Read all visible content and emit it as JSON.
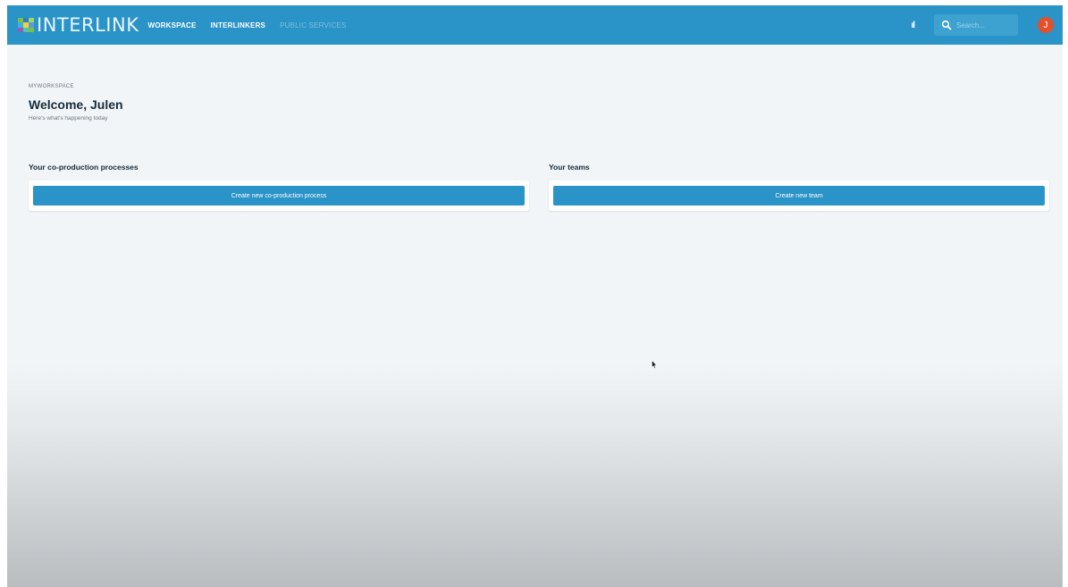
{
  "header": {
    "logo_text": "INTERLINK",
    "nav": [
      {
        "label": "WORKSPACE"
      },
      {
        "label": "INTERLINKERS"
      },
      {
        "label": "PUBLIC SERVICES"
      }
    ],
    "language_icon_text": "ıl",
    "search_placeholder": "Search...",
    "avatar_initial": "J"
  },
  "page": {
    "overline": "MYWORKSPACE",
    "title": "Welcome, Julen",
    "subtitle": "Here's what's happening today"
  },
  "processes": {
    "title": "Your co-production processes",
    "button_label": "Create new co-production process"
  },
  "teams": {
    "title": "Your teams",
    "button_label": "Create new team"
  },
  "colors": {
    "primary": "#2a93c7",
    "background": "#f1f5f8",
    "avatar": "#e4502a"
  },
  "icons": {
    "search": "search-icon",
    "language": "language-icon",
    "cursor": "mouse-pointer-icon"
  }
}
